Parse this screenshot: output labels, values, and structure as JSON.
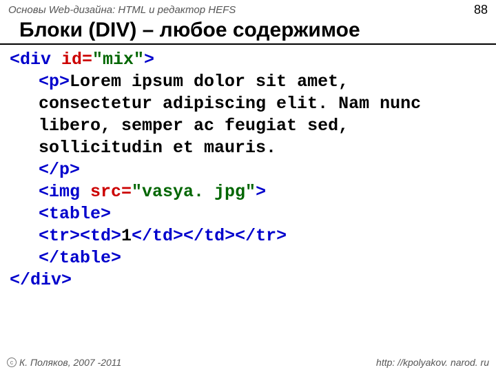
{
  "header": {
    "breadcrumb": "Основы Web-дизайна: HTML и редактор HEFS",
    "page_number": "88"
  },
  "title": "Блоки (DIV) – любое содержимое",
  "code": {
    "l1": {
      "open": "<div ",
      "attr": "id=",
      "val": "\"mix\"",
      "close": ">"
    },
    "l2": {
      "tag_open": "<p>",
      "text": "Lorem ipsum dolor sit amet,"
    },
    "l3": "consectetur adipiscing elit. Nam nunc",
    "l4": "libero, semper ac feugiat sed,",
    "l5": "sollicitudin et mauris.",
    "l6": "</p>",
    "l7": {
      "open": "<img ",
      "attr": "src=",
      "val": "\"vasya. jpg\"",
      "close": ">"
    },
    "l8": "<table>",
    "l9": {
      "a": "<tr><td>",
      "b": "1",
      "c": "</td></td></tr>"
    },
    "l10": "</table>",
    "l11": "</div>"
  },
  "footer": {
    "copyright": "К. Поляков, 2007 -2011",
    "url": "http: //kpolyakov. narod. ru"
  }
}
